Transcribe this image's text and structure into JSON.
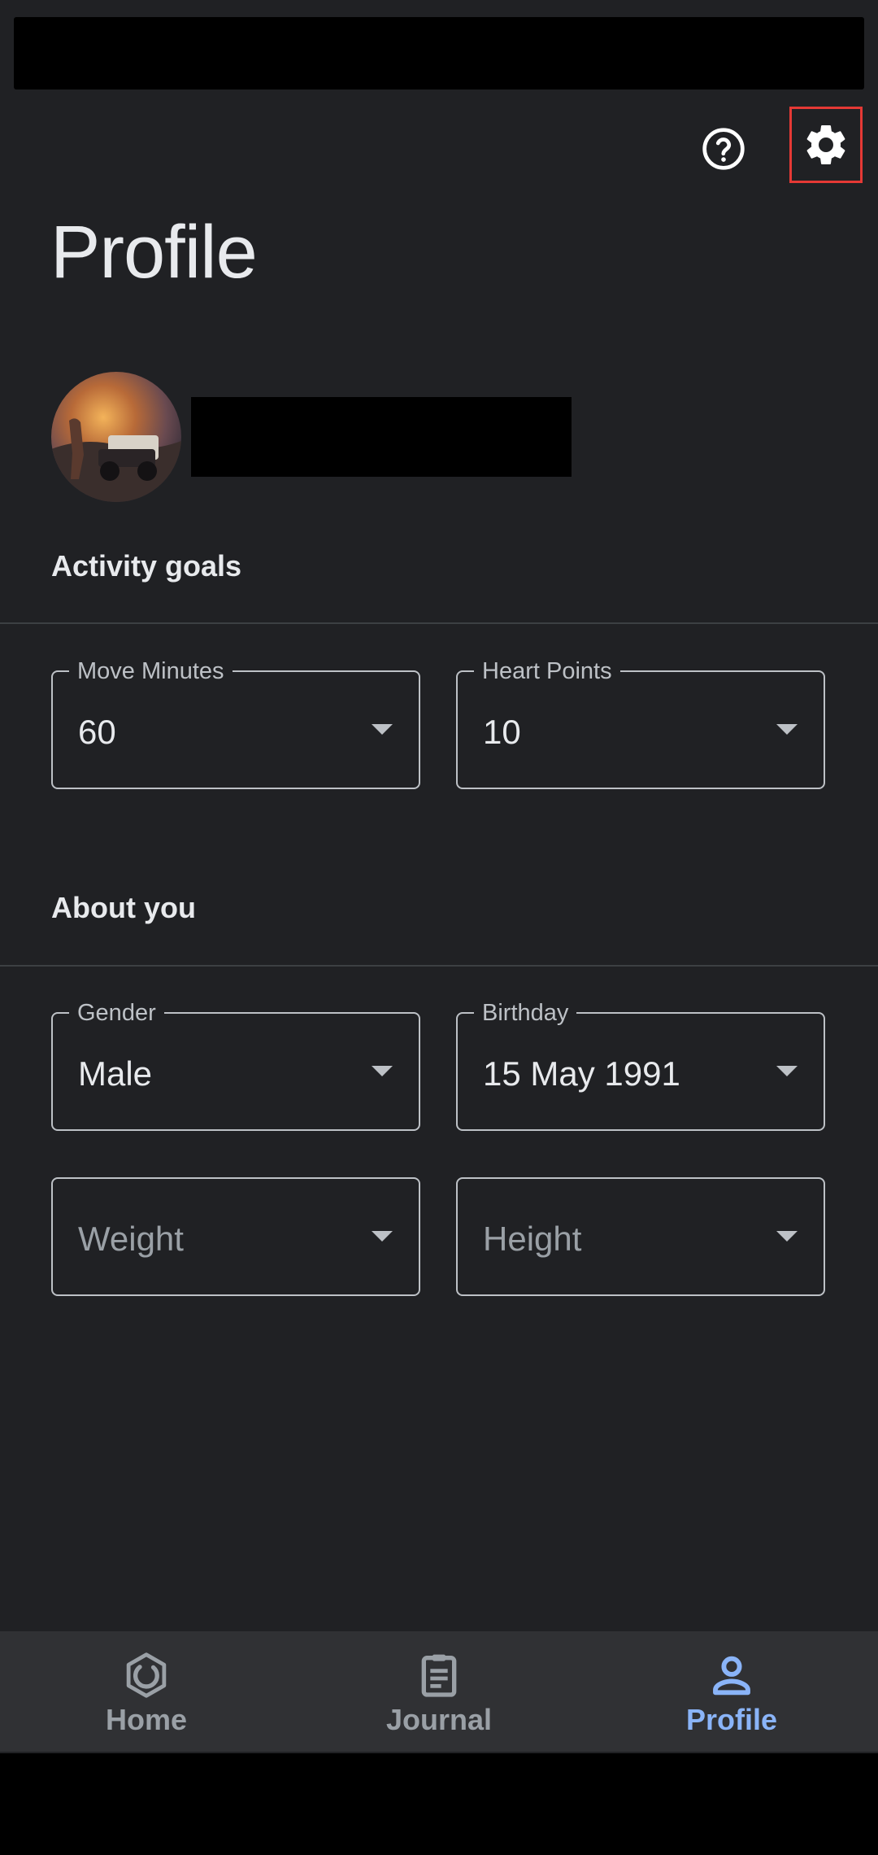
{
  "header": {
    "title": "Profile",
    "help_icon": "help-circle-icon",
    "settings_icon": "gear-icon"
  },
  "profile": {
    "avatar": "avatar"
  },
  "activity_goals": {
    "title": "Activity goals",
    "move_minutes": {
      "label": "Move Minutes",
      "value": "60"
    },
    "heart_points": {
      "label": "Heart Points",
      "value": "10"
    }
  },
  "about_you": {
    "title": "About you",
    "gender": {
      "label": "Gender",
      "value": "Male"
    },
    "birthday": {
      "label": "Birthday",
      "value": "15 May 1991"
    },
    "weight": {
      "placeholder": "Weight"
    },
    "height": {
      "placeholder": "Height"
    }
  },
  "bottom_nav": {
    "items": [
      {
        "label": "Home",
        "icon": "home-ring-icon"
      },
      {
        "label": "Journal",
        "icon": "clipboard-icon"
      },
      {
        "label": "Profile",
        "icon": "person-icon",
        "selected": true
      }
    ],
    "active_color": "#8ab4f8",
    "inactive_color": "#9aa0a6"
  },
  "colors": {
    "background": "#202124",
    "highlight": "#e53935"
  }
}
